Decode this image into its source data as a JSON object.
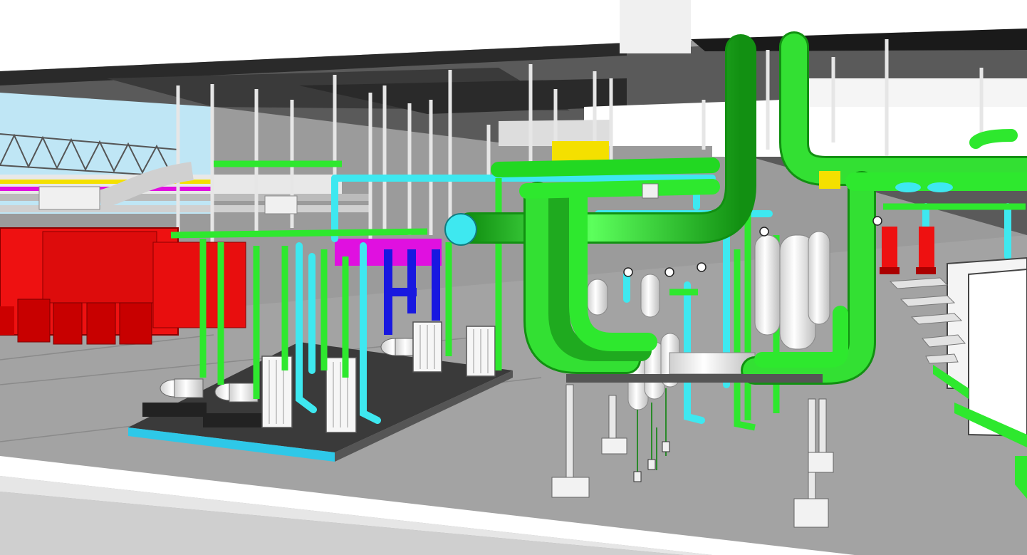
{
  "scene": {
    "kind": "3D BIM model render of a mechanical plant room",
    "colors": {
      "sky": "#bfe6f5",
      "slab": "#ffffff",
      "slab_underside": "#2a2a2a",
      "floor": "#9b9b9b",
      "chilled_water_pipe": "#2ee82e",
      "condenser_pipe": "#3ee8f0",
      "blue_pipe": "#1818e0",
      "red_equipment": "#ee1111",
      "magenta_duct": "#e010e0",
      "yellow_duct": "#f4e000",
      "vessel": "#f2f2f2",
      "skid_base": "#3a3a3a",
      "skid_trim": "#2ec8e8"
    },
    "equipment": [
      {
        "id": "pump-1",
        "type": "end-suction pump"
      },
      {
        "id": "pump-2",
        "type": "end-suction pump"
      },
      {
        "id": "pump-3",
        "type": "end-suction pump"
      },
      {
        "id": "hx-1",
        "type": "plate heat exchanger"
      },
      {
        "id": "hx-2",
        "type": "plate heat exchanger"
      },
      {
        "id": "hx-3",
        "type": "plate heat exchanger"
      },
      {
        "id": "hx-4",
        "type": "plate heat exchanger"
      },
      {
        "id": "tank-1",
        "type": "vertical vessel"
      },
      {
        "id": "tank-2",
        "type": "vertical vessel"
      },
      {
        "id": "tank-3",
        "type": "vertical vessel"
      },
      {
        "id": "chiller-bank",
        "type": "red chiller units"
      },
      {
        "id": "fire-pumps",
        "type": "red vertical pumps"
      }
    ]
  }
}
